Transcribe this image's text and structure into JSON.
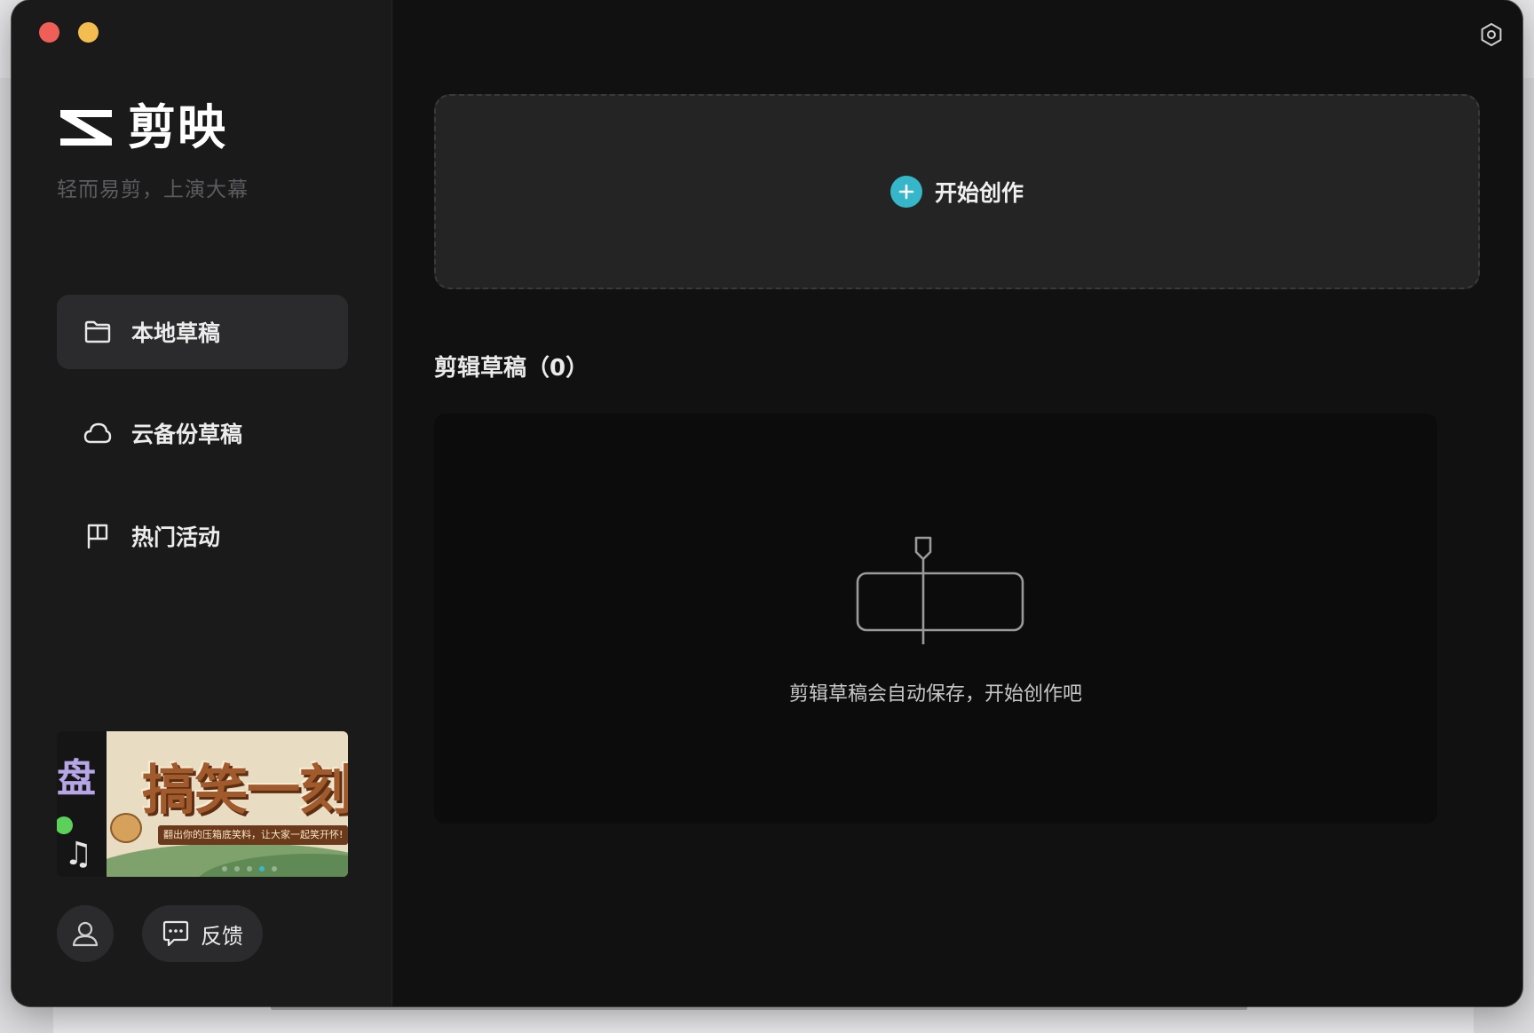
{
  "app": {
    "name": "剪映",
    "slogan": "轻而易剪，上演大幕"
  },
  "sidebar": {
    "items": [
      {
        "label": "本地草稿",
        "icon": "folder-icon",
        "active": true
      },
      {
        "label": "云备份草稿",
        "icon": "cloud-icon",
        "active": false
      },
      {
        "label": "热门活动",
        "icon": "flag-icon",
        "active": false
      }
    ],
    "banner": {
      "title": "搞笑一刻",
      "subtitle": "翻出你的压箱底笑料，让大家一起笑开怀!",
      "slides": 5,
      "active_slide": 4
    },
    "feedback_label": "反馈"
  },
  "main": {
    "create_label": "开始创作",
    "drafts_title": "剪辑草稿（0）",
    "empty_text": "剪辑草稿会自动保存，开始创作吧"
  },
  "colors": {
    "accent": "#35b7c9",
    "window_bg": "#111112",
    "sidebar_bg": "#1a1a1b",
    "close": "#ee5f57",
    "minimize": "#f4bd4f"
  }
}
